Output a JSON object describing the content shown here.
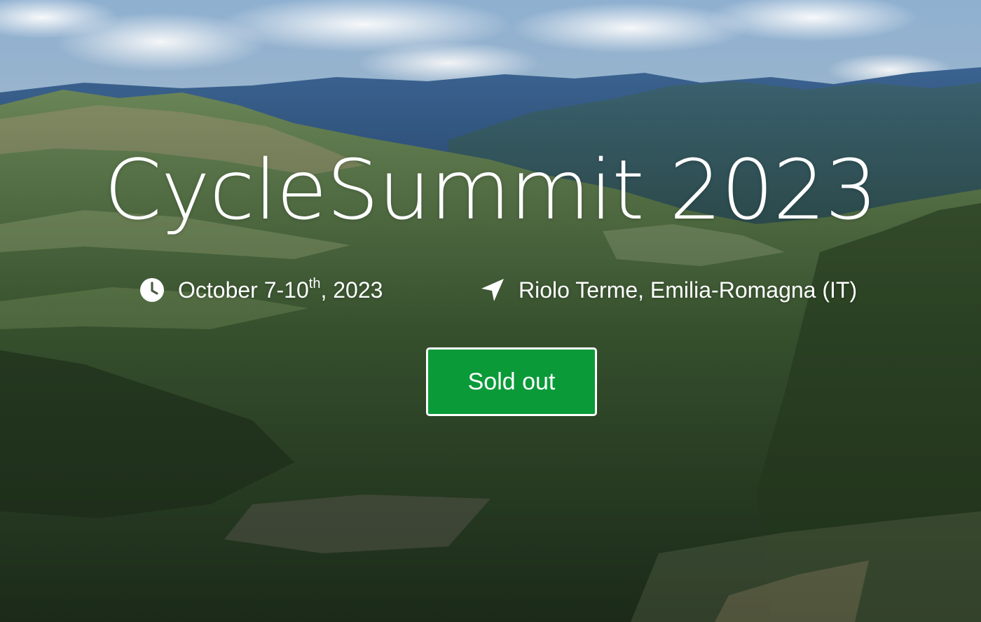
{
  "hero": {
    "title": "CycleSummit 2023",
    "date": {
      "icon": "clock-icon",
      "text_before_sup": "October 7-10",
      "superscript": "th",
      "text_after_sup": ", 2023"
    },
    "location": {
      "icon": "location-arrow-icon",
      "text": "Riolo Terme, Emilia-Romagna (IT)"
    },
    "cta": {
      "label": "Sold out",
      "color": "#0a9a38"
    }
  }
}
